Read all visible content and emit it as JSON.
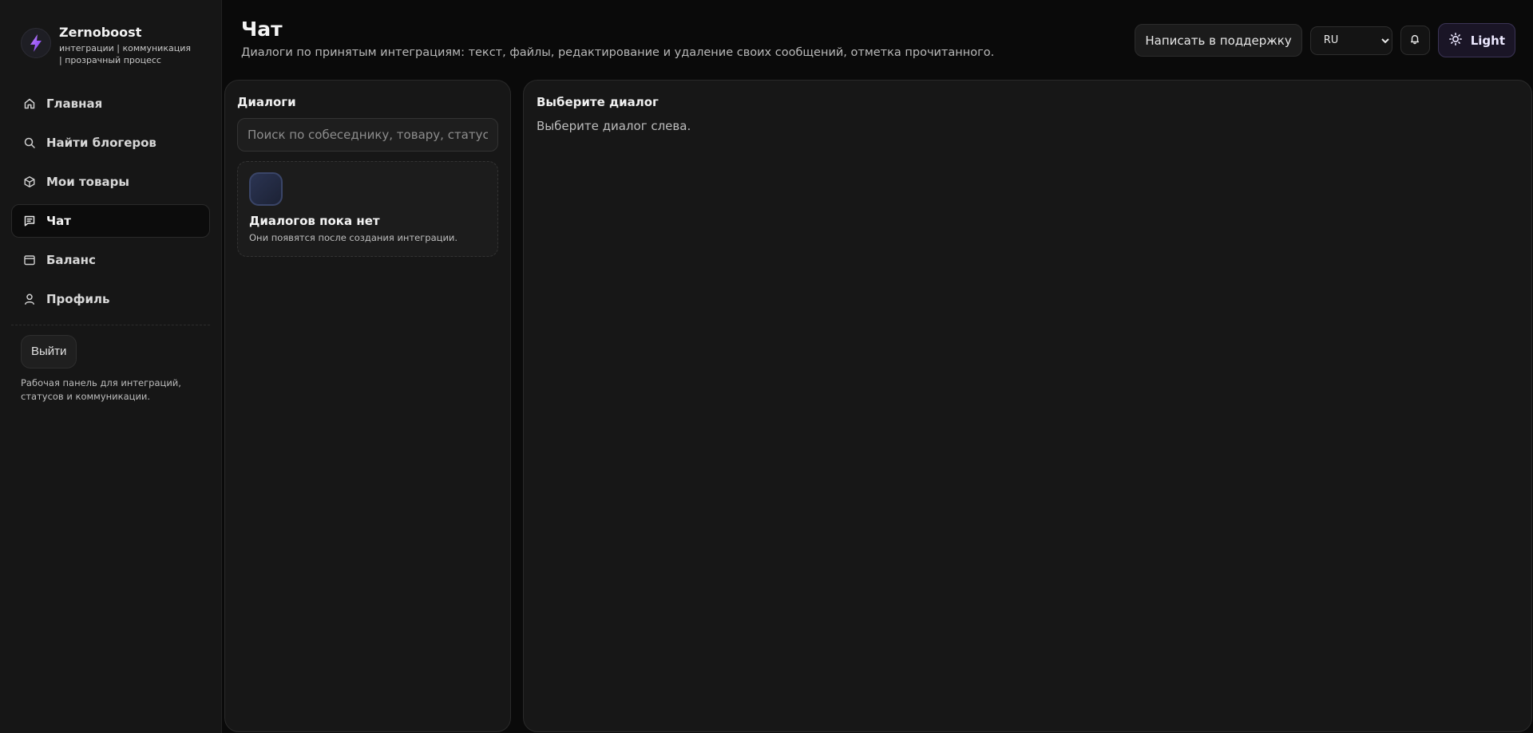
{
  "brand": {
    "name": "Zernoboost",
    "tagline": "интеграции | коммуникация | прозрачный процесс"
  },
  "sidebar": {
    "items": [
      {
        "label": "Главная",
        "icon": "home-icon",
        "active": false
      },
      {
        "label": "Найти блогеров",
        "icon": "search-icon",
        "active": false
      },
      {
        "label": "Мои товары",
        "icon": "box-icon",
        "active": false
      },
      {
        "label": "Чат",
        "icon": "chat-icon",
        "active": true
      },
      {
        "label": "Баланс",
        "icon": "wallet-icon",
        "active": false
      },
      {
        "label": "Профиль",
        "icon": "user-icon",
        "active": false
      }
    ],
    "logout_label": "Выйти",
    "note": "Рабочая панель для интеграций, статусов и коммуникации."
  },
  "header": {
    "title": "Чат",
    "description": "Диалоги по принятым интеграциям: текст, файлы, редактирование и удаление своих сообщений, отметка прочитанного.",
    "support_label": "Написать в поддержку",
    "language": "RU",
    "theme_label": "Light"
  },
  "dialogs": {
    "title": "Диалоги",
    "search_placeholder": "Поиск по собеседнику, товару, статусу или",
    "empty_title": "Диалогов пока нет",
    "empty_sub": "Они появятся после создания интеграции."
  },
  "conversation": {
    "title": "Выберите диалог",
    "subtitle": "Выберите диалог слева."
  },
  "colors": {
    "background": "#0a0a0a",
    "panel": "#171717",
    "accent": "#8b5cf6"
  }
}
